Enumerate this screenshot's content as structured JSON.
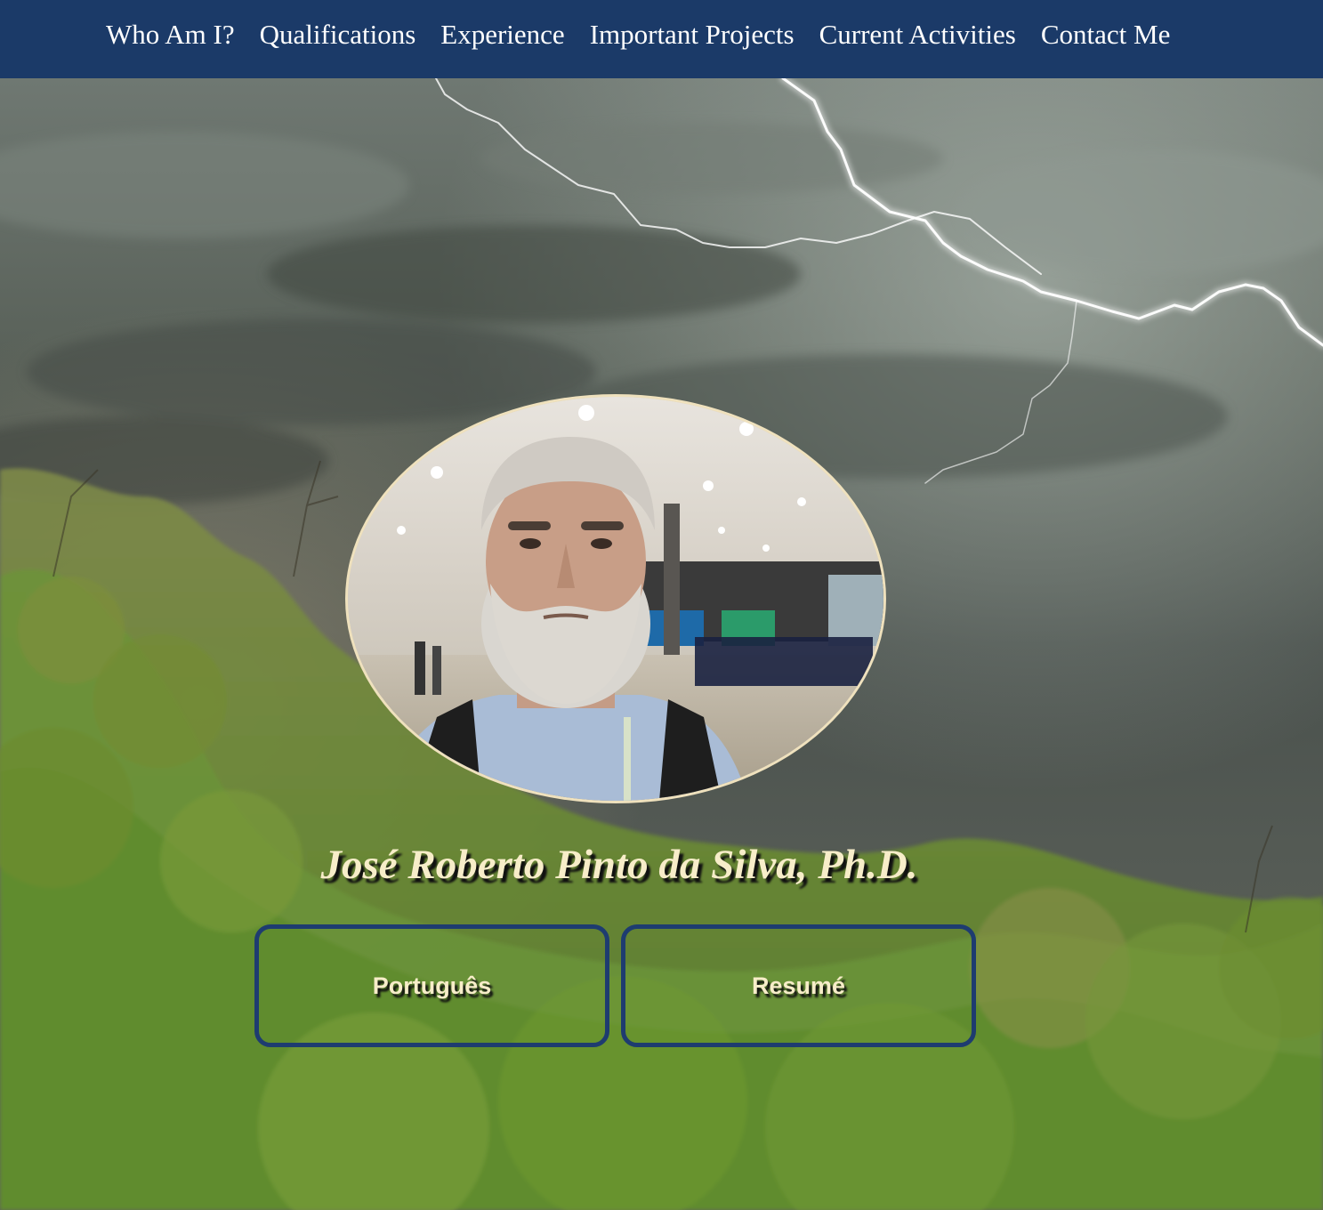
{
  "nav": {
    "items": [
      {
        "label": "Who Am I?"
      },
      {
        "label": "Qualifications"
      },
      {
        "label": "Experience"
      },
      {
        "label": "Important Projects"
      },
      {
        "label": "Current Activities"
      },
      {
        "label": "Contact Me"
      }
    ]
  },
  "hero": {
    "name": "José Roberto Pinto da Silva, Ph.D.",
    "buttons": {
      "portugues": "Português",
      "resume": "Resumé"
    }
  },
  "colors": {
    "nav_background": "#1b3a68",
    "button_border": "#1e3c70",
    "name_text": "#f7edc9",
    "portrait_border": "#efe1bd"
  }
}
